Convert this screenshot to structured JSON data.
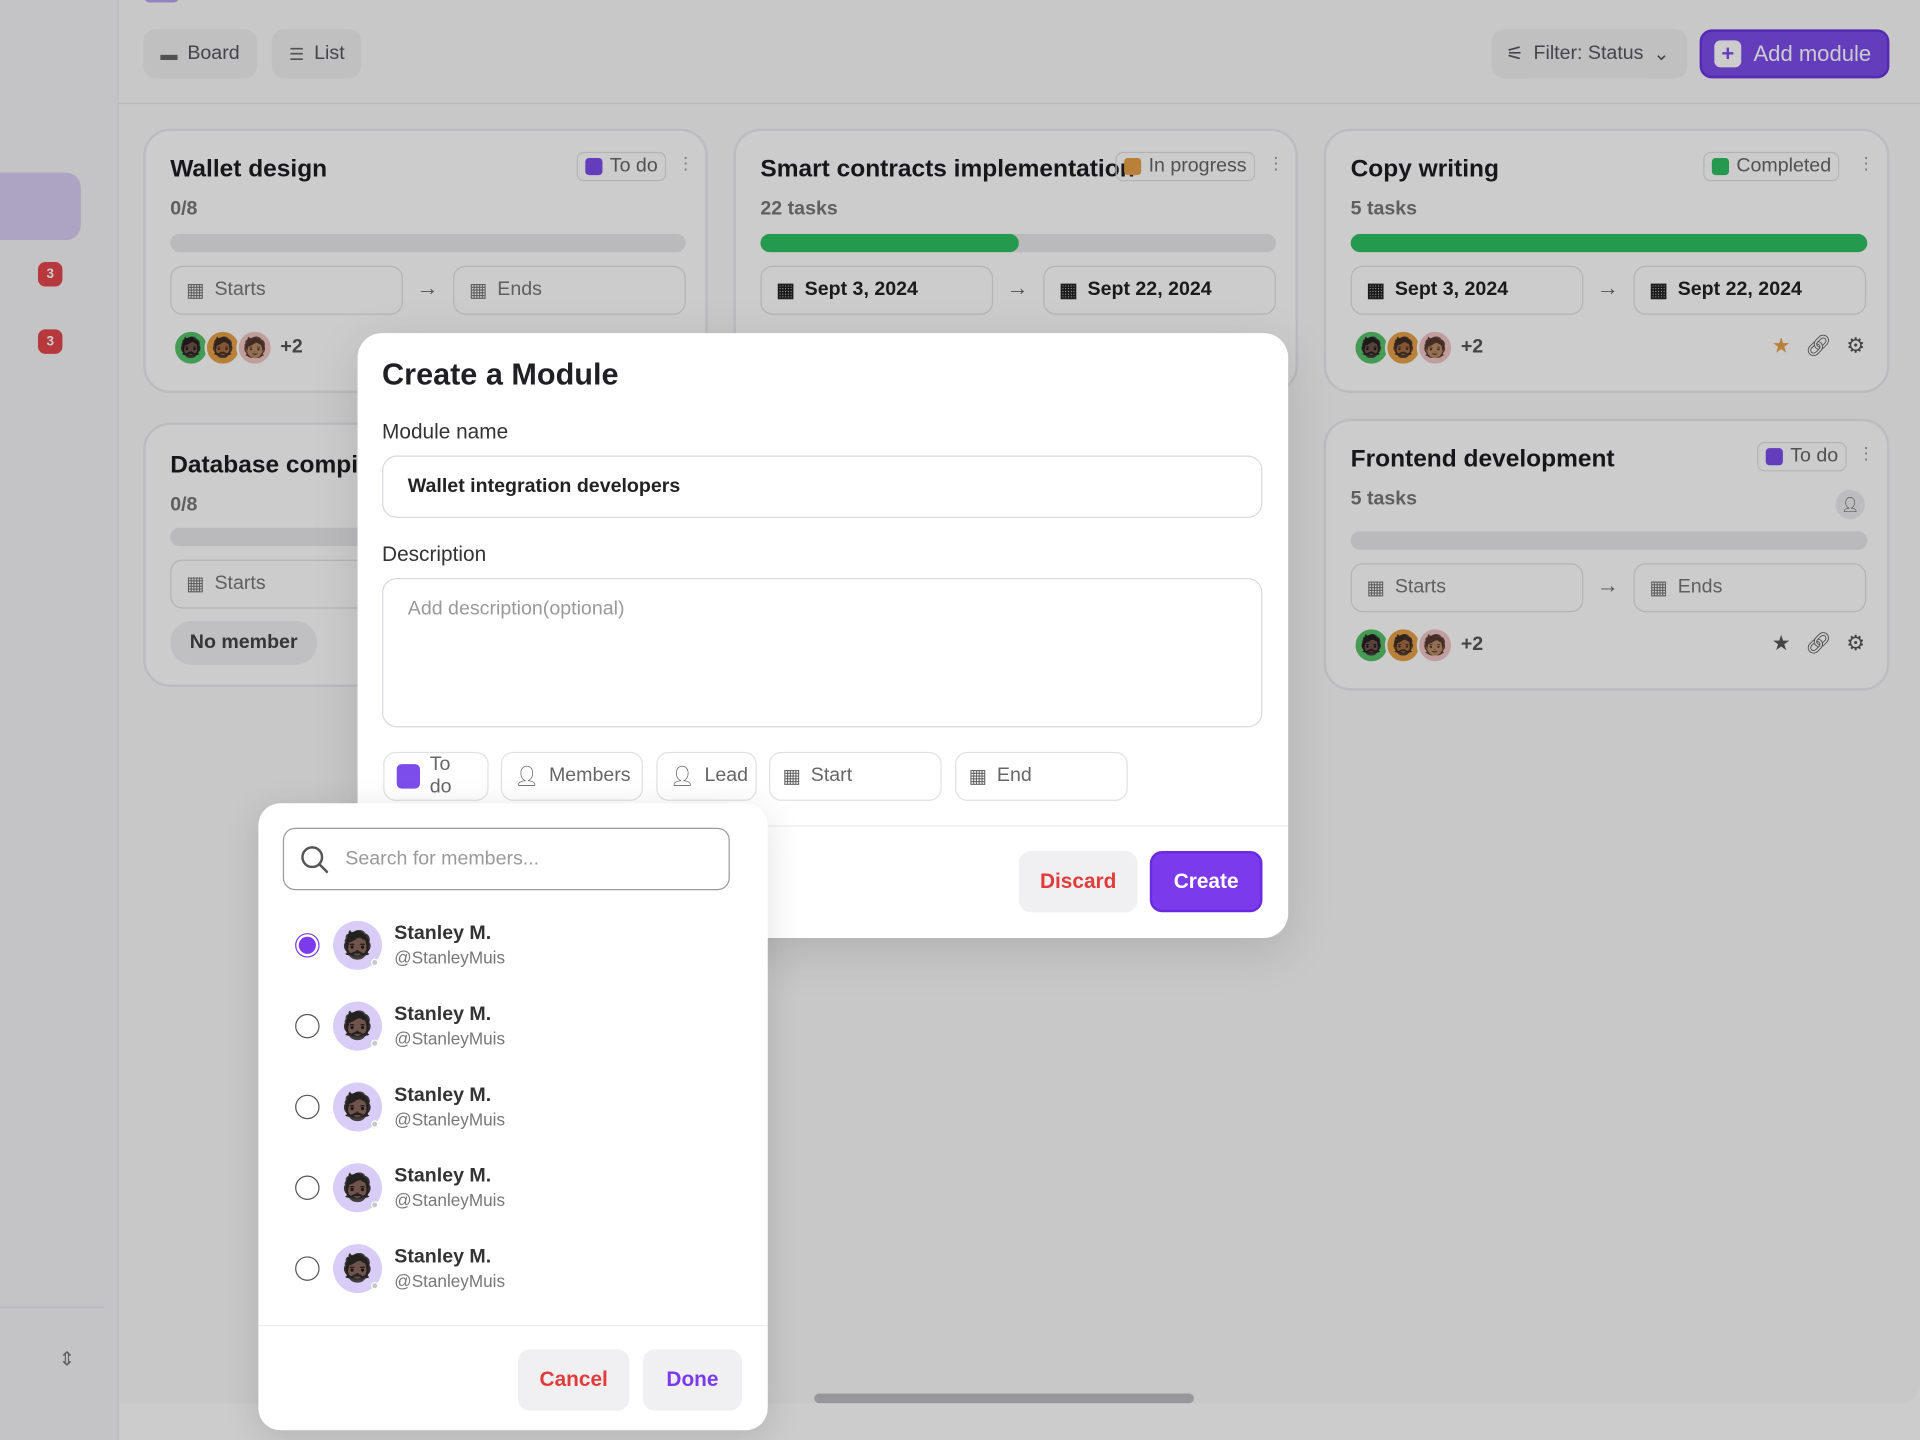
{
  "sidebar": {
    "badges": [
      "3",
      "3"
    ]
  },
  "toolbar": {
    "board_label": "Board",
    "list_label": "List",
    "filter_label": "Filter: Status",
    "add_label": "Add module"
  },
  "cards": [
    {
      "title": "Wallet design",
      "status": "To do",
      "status_color": "#7c4deb",
      "count": "0/8",
      "progress": 0,
      "start": "Starts",
      "end": "Ends",
      "more": "+2"
    },
    {
      "title": "Smart contracts implementation",
      "status": "In progress",
      "status_color": "#e7a148",
      "count": "22 tasks",
      "progress": 0.5,
      "start": "Sept 3, 2024",
      "end": "Sept 22, 2024"
    },
    {
      "title": "Copy writing",
      "status": "Completed",
      "status_color": "#2fc061",
      "count": "5 tasks",
      "progress": 1.0,
      "start": "Sept 3, 2024",
      "end": "Sept 22, 2024",
      "more": "+2"
    },
    {
      "title": "Database compilin",
      "count": "0/8",
      "progress": 0,
      "start": "Starts",
      "members": "No member"
    },
    {
      "title": "Frontend development",
      "status": "To do",
      "status_color": "#7c4deb",
      "count": "5 tasks",
      "progress": 0,
      "start": "Starts",
      "end": "Ends",
      "more": "+2"
    }
  ],
  "modal": {
    "title": "Create a Module",
    "name_label": "Module name",
    "name_value": "Wallet integration developers",
    "desc_label": "Description",
    "desc_placeholder": "Add description(optional)",
    "chips": {
      "status": "To do",
      "members": "Members",
      "lead": "Lead",
      "start": "Start",
      "end": "End"
    },
    "discard": "Discard",
    "create": "Create"
  },
  "members_popup": {
    "search_placeholder": "Search for members...",
    "members": [
      {
        "name": "Stanley M.",
        "handle": "@StanleyMuis",
        "selected": true
      },
      {
        "name": "Stanley M.",
        "handle": "@StanleyMuis",
        "selected": false
      },
      {
        "name": "Stanley M.",
        "handle": "@StanleyMuis",
        "selected": false
      },
      {
        "name": "Stanley M.",
        "handle": "@StanleyMuis",
        "selected": false
      },
      {
        "name": "Stanley M.",
        "handle": "@StanleyMuis",
        "selected": false
      }
    ],
    "cancel": "Cancel",
    "done": "Done"
  },
  "icons": {
    "calendar": "calendar-icon",
    "search": "search-icon",
    "star": "star-icon",
    "link": "link-icon",
    "gear": "gear-icon"
  },
  "colors": {
    "accent": "#7c3aed",
    "progress": "#2fc061",
    "danger": "#e13b3b"
  }
}
